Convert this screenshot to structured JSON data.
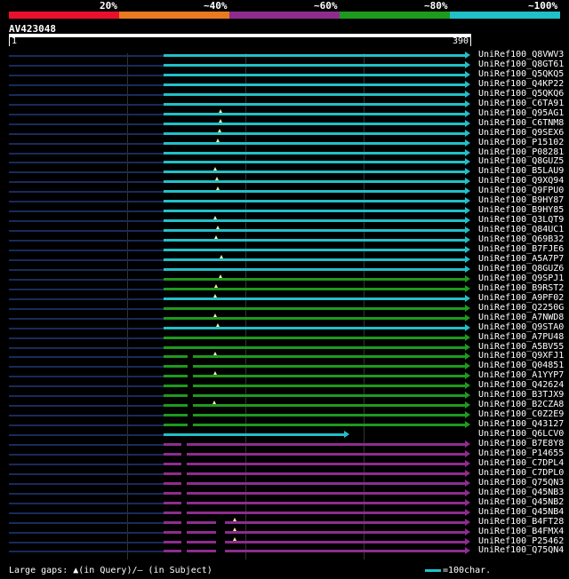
{
  "scale": {
    "labels": [
      "20%",
      "~40%",
      "~60%",
      "~80%",
      "~100%"
    ],
    "colors": [
      "#e8112d",
      "#e87a20",
      "#8e2c8e",
      "#1e9a1e",
      "#21c0c8"
    ]
  },
  "query": {
    "name": "AV423048",
    "start": "1",
    "end": "390"
  },
  "legend": {
    "gaps_text": "Large gaps: ▲(in Query)/— (in Subject)",
    "scale_text": "=100char."
  },
  "colors": {
    "background": "#000000",
    "cyan": "#21c0c8",
    "green": "#1e9a1e",
    "purple": "#8e2c8e",
    "dark_blue": "#1a2a5a"
  },
  "hits": [
    {
      "id": "UniRef100_Q8VWV3",
      "color": "cyan"
    },
    {
      "id": "UniRef100_Q8GT61",
      "color": "cyan"
    },
    {
      "id": "UniRef100_Q5QKQ5",
      "color": "cyan"
    },
    {
      "id": "UniRef100_Q4KP22",
      "color": "cyan"
    },
    {
      "id": "UniRef100_Q5QKQ6",
      "color": "cyan"
    },
    {
      "id": "UniRef100_C6TA91",
      "color": "cyan"
    },
    {
      "id": "UniRef100_Q95AG1",
      "color": "cyan"
    },
    {
      "id": "UniRef100_C6TNM8",
      "color": "cyan"
    },
    {
      "id": "UniRef100_Q9SEX6",
      "color": "cyan"
    },
    {
      "id": "UniRef100_P15102",
      "color": "cyan"
    },
    {
      "id": "UniRef100_P08281",
      "color": "cyan"
    },
    {
      "id": "UniRef100_Q8GUZ5",
      "color": "cyan"
    },
    {
      "id": "UniRef100_B5LAU9",
      "color": "cyan"
    },
    {
      "id": "UniRef100_Q9XQ94",
      "color": "cyan"
    },
    {
      "id": "UniRef100_Q9FPU0",
      "color": "cyan"
    },
    {
      "id": "UniRef100_B9HY87",
      "color": "cyan"
    },
    {
      "id": "UniRef100_B9HY85",
      "color": "cyan"
    },
    {
      "id": "UniRef100_Q3LQT9",
      "color": "cyan"
    },
    {
      "id": "UniRef100_Q84UC1",
      "color": "cyan"
    },
    {
      "id": "UniRef100_Q69B32",
      "color": "cyan"
    },
    {
      "id": "UniRef100_B7FJE6",
      "color": "cyan"
    },
    {
      "id": "UniRef100_A5A7P7",
      "color": "cyan"
    },
    {
      "id": "UniRef100_Q8GUZ6",
      "color": "cyan"
    },
    {
      "id": "UniRef100_Q9SPJ1",
      "color": "green"
    },
    {
      "id": "UniRef100_B9RST2",
      "color": "green"
    },
    {
      "id": "UniRef100_A9PF02",
      "color": "cyan"
    },
    {
      "id": "UniRef100_Q2250G",
      "color": "green"
    },
    {
      "id": "UniRef100_A7NWD8",
      "color": "green"
    },
    {
      "id": "UniRef100_Q9STA0",
      "color": "cyan"
    },
    {
      "id": "UniRef100_A7PU48",
      "color": "green"
    },
    {
      "id": "UniRef100_A5BV55",
      "color": "green"
    },
    {
      "id": "UniRef100_Q9XFJ1",
      "color": "green"
    },
    {
      "id": "UniRef100_Q04851",
      "color": "green"
    },
    {
      "id": "UniRef100_A1YYP7",
      "color": "green"
    },
    {
      "id": "UniRef100_Q42624",
      "color": "green"
    },
    {
      "id": "UniRef100_B3TJX9",
      "color": "green"
    },
    {
      "id": "UniRef100_B2CZA8",
      "color": "green"
    },
    {
      "id": "UniRef100_C0Z2E9",
      "color": "green"
    },
    {
      "id": "UniRef100_Q43127",
      "color": "green"
    },
    {
      "id": "UniRef100_Q6LCV0",
      "color": "cyan"
    },
    {
      "id": "UniRef100_B7E8Y8",
      "color": "purple"
    },
    {
      "id": "UniRef100_P14655",
      "color": "purple"
    },
    {
      "id": "UniRef100_C7DPL4",
      "color": "purple"
    },
    {
      "id": "UniRef100_C7DPL0",
      "color": "purple"
    },
    {
      "id": "UniRef100_Q75QN3",
      "color": "purple"
    },
    {
      "id": "UniRef100_Q45NB3",
      "color": "purple"
    },
    {
      "id": "UniRef100_Q45NB2",
      "color": "purple"
    },
    {
      "id": "UniRef100_Q45NB4",
      "color": "purple"
    },
    {
      "id": "UniRef100_B4FT28",
      "color": "purple"
    },
    {
      "id": "UniRef100_B4FMX4",
      "color": "purple"
    },
    {
      "id": "UniRef100_P25462",
      "color": "purple"
    },
    {
      "id": "UniRef100_Q75QN4",
      "color": "purple"
    }
  ]
}
